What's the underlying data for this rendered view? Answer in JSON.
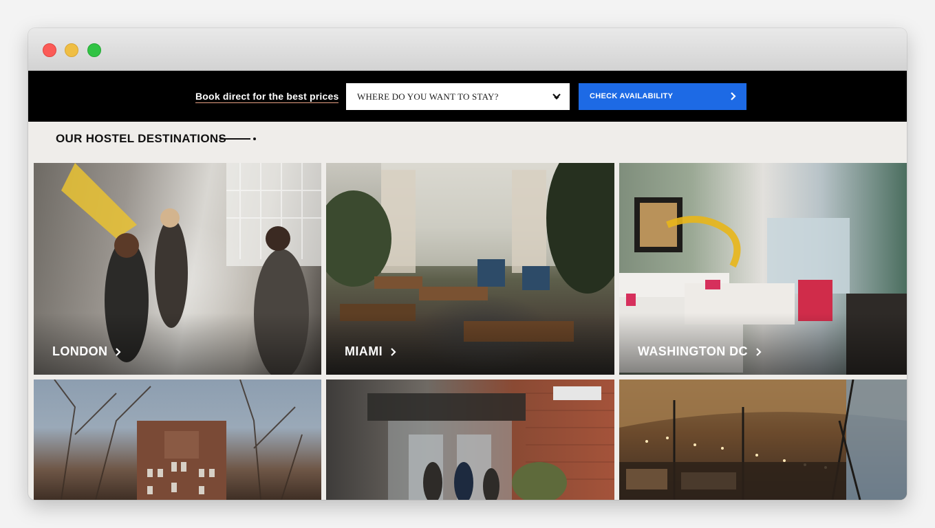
{
  "window": {
    "controls": [
      "close",
      "minimize",
      "maximize"
    ]
  },
  "topbar": {
    "promo_text": "Book direct for the best prices",
    "destination_placeholder": "WHERE DO YOU WANT TO STAY?",
    "check_label": "CHECK AVAILABILITY",
    "accent_color": "#1d6ae5"
  },
  "section": {
    "title": "OUR HOSTEL DESTINATIONS"
  },
  "destinations": [
    {
      "city": "LONDON"
    },
    {
      "city": "MIAMI"
    },
    {
      "city": "WASHINGTON DC"
    }
  ],
  "icons": {
    "dropdown": "chevron-down-icon",
    "button": "arrow-right-icon",
    "tile": "chevron-right-icon"
  }
}
